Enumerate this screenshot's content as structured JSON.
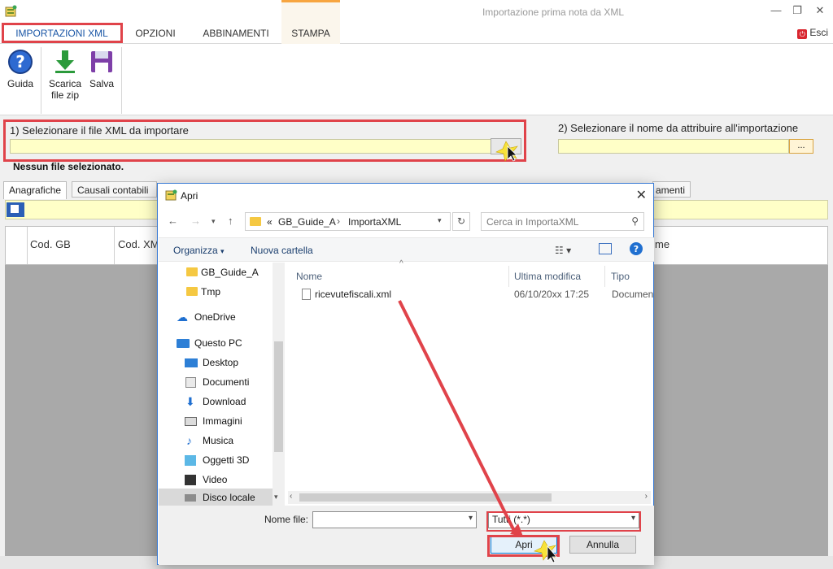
{
  "window": {
    "title": "Importazione prima nota da XML"
  },
  "ribbon": {
    "tabs": [
      {
        "label": "IMPORTAZIONI XML"
      },
      {
        "label": "OPZIONI"
      },
      {
        "label": "ABBINAMENTI"
      },
      {
        "label": "STAMPA"
      }
    ],
    "exit_label": "Esci"
  },
  "toolbar": {
    "guide_label": "Guida",
    "download_label_1": "Scarica",
    "download_label_2": "file zip",
    "save_label": "Salva"
  },
  "section1": {
    "label": "1) Selezionare il file XML da importare",
    "status": "Nessun file selezionato."
  },
  "section2": {
    "label": "2) Selezionare il nome da attribuire all'importazione",
    "button_label": "..."
  },
  "background_tabs": [
    {
      "label": "Anagrafiche"
    },
    {
      "label": "Causali contabili"
    },
    {
      "label": "amenti"
    }
  ],
  "grid": {
    "columns": [
      "Cod. GB",
      "Cod. XM",
      "me"
    ]
  },
  "dialog": {
    "title": "Apri",
    "address": {
      "root_glyph": "«",
      "segments": [
        "GB_Guide_A",
        "ImportaXML"
      ]
    },
    "search_placeholder": "Cerca in ImportaXML",
    "organize_label": "Organizza",
    "new_folder_label": "Nuova cartella",
    "nav_items": [
      {
        "label": "GB_Guide_A",
        "icon": "folder-icon"
      },
      {
        "label": "Tmp",
        "icon": "folder-icon"
      },
      {
        "label": "OneDrive",
        "icon": "cloud-icon"
      },
      {
        "label": "Questo PC",
        "icon": "computer-icon"
      },
      {
        "label": "Desktop",
        "icon": "desktop-icon"
      },
      {
        "label": "Documenti",
        "icon": "documents-icon"
      },
      {
        "label": "Download",
        "icon": "download-icon"
      },
      {
        "label": "Immagini",
        "icon": "pictures-icon"
      },
      {
        "label": "Musica",
        "icon": "music-icon"
      },
      {
        "label": "Oggetti 3D",
        "icon": "3d-objects-icon"
      },
      {
        "label": "Video",
        "icon": "video-icon"
      },
      {
        "label": "Disco locale (C:)",
        "icon": "drive-icon"
      }
    ],
    "columns": {
      "name": "Nome",
      "modified": "Ultima modifica",
      "type": "Tipo"
    },
    "files": [
      {
        "name": "ricevutefiscali.xml",
        "modified": "06/10/20xx 17:25",
        "type": "Documen"
      }
    ],
    "filename_label": "Nome file:",
    "filename_value": "",
    "filter_value": "Tutti (*.*)",
    "open_label": "Apri",
    "cancel_label": "Annulla"
  },
  "colors": {
    "highlight": "#e0434a",
    "accent": "#1a56a6",
    "input_yellow": "#ffffc7"
  }
}
